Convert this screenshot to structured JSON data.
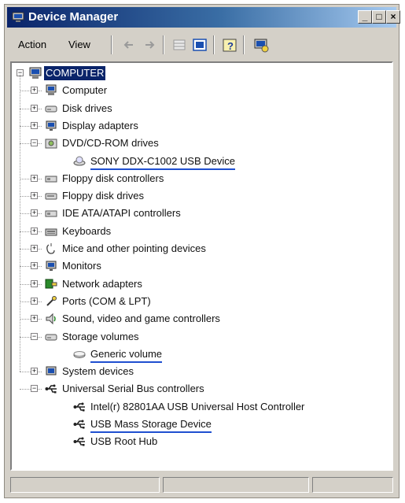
{
  "window": {
    "title": "Device Manager",
    "controls": {
      "minimize": "_",
      "maximize": "□",
      "close": "×"
    }
  },
  "toolbar": {
    "action_label": "Action",
    "view_label": "View",
    "tools": [
      "back-arrow-icon",
      "forward-arrow-icon",
      "properties-grid-icon",
      "details-pane-icon",
      "help-icon",
      "scan-hardware-icon"
    ]
  },
  "tree": {
    "root": "COMPUTER",
    "items": [
      {
        "label": "Computer",
        "expander": "+",
        "icon": "computer-icon"
      },
      {
        "label": "Disk drives",
        "expander": "+",
        "icon": "disk-drive-icon"
      },
      {
        "label": "Display adapters",
        "expander": "+",
        "icon": "monitor-icon"
      },
      {
        "label": "DVD/CD-ROM drives",
        "expander": "−",
        "icon": "cdrom-icon"
      },
      {
        "label": "SONY DDX-C1002 USB Device",
        "child": true,
        "icon": "cdrom-device-icon"
      },
      {
        "label": "Floppy disk controllers",
        "expander": "+",
        "icon": "controller-icon"
      },
      {
        "label": "Floppy disk drives",
        "expander": "+",
        "icon": "floppy-drive-icon"
      },
      {
        "label": "IDE ATA/ATAPI controllers",
        "expander": "+",
        "icon": "controller-icon"
      },
      {
        "label": "Keyboards",
        "expander": "+",
        "icon": "keyboard-icon"
      },
      {
        "label": "Mice and other pointing devices",
        "expander": "+",
        "icon": "mouse-icon"
      },
      {
        "label": "Monitors",
        "expander": "+",
        "icon": "monitor-icon"
      },
      {
        "label": "Network adapters",
        "expander": "+",
        "icon": "network-icon"
      },
      {
        "label": "Ports (COM & LPT)",
        "expander": "+",
        "icon": "port-icon"
      },
      {
        "label": "Sound, video and game controllers",
        "expander": "+",
        "icon": "sound-icon"
      },
      {
        "label": "Storage volumes",
        "expander": "−",
        "icon": "storage-icon"
      },
      {
        "label": "Generic volume",
        "child": true,
        "icon": "volume-icon"
      },
      {
        "label": "System devices",
        "expander": "+",
        "icon": "system-icon"
      },
      {
        "label": "Universal Serial Bus controllers",
        "expander": "−",
        "icon": "usb-icon"
      },
      {
        "label": "Intel(r) 82801AA USB Universal Host Controller",
        "child": true,
        "icon": "usb-icon"
      },
      {
        "label": "USB Mass Storage Device",
        "child": true,
        "icon": "usb-icon"
      },
      {
        "label": "USB Root Hub",
        "child": true,
        "icon": "usb-icon"
      }
    ]
  },
  "colors": {
    "title_start": "#0a246a",
    "title_end": "#a6caf0",
    "selection": "#0a246a",
    "highlight_underline": "#1f4fd0",
    "chrome": "#d4d0c8"
  }
}
